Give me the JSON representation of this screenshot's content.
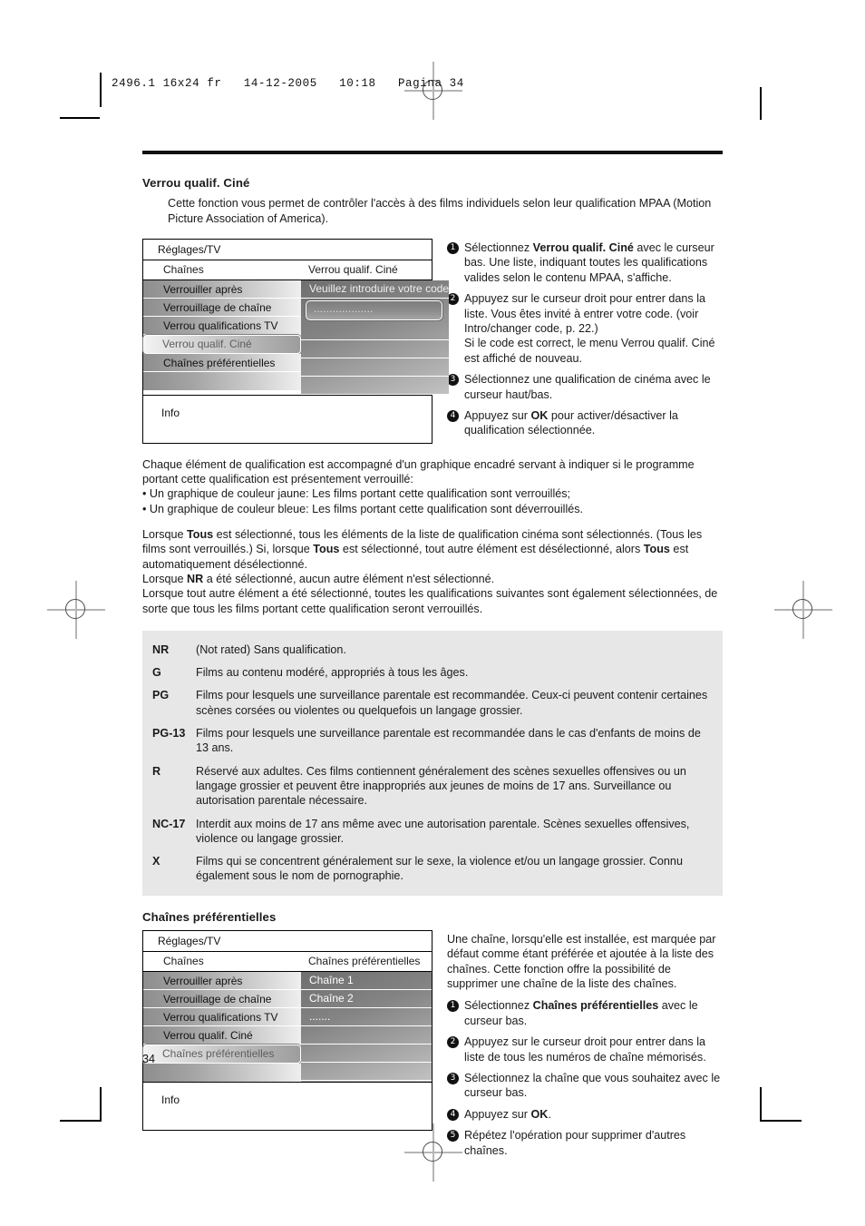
{
  "print_marks": {
    "slug_line": "2496.1 16x24 fr   14-12-2005   10:18   Pagina 34"
  },
  "folio": "34",
  "section1": {
    "title": "Verrou qualif. Ciné",
    "intro": "Cette fonction vous permet de contrôler l'accès à des films individuels selon leur qualification MPAA (Motion Picture Association of America).",
    "tv_menu": {
      "breadcrumb": "Réglages/TV",
      "left_header": "Chaînes",
      "right_header": "Verrou qualif. Ciné",
      "left_items": [
        "Verrouiller après",
        "Verrouillage de chaîne",
        "Verrou qualifications TV",
        "Verrou qualif. Ciné",
        "Chaînes préférentielles"
      ],
      "selected_left_item": "Verrou qualif. Ciné",
      "right_prompt": "Veuillez introduire votre code",
      "code_field_value": "...................",
      "info_label": "Info"
    },
    "steps": [
      {
        "num": "1",
        "html": "Sélectionnez <b>Verrou qualif. Ciné</b> avec le curseur bas. Une liste, indiquant toutes les qualifications valides selon le contenu MPAA, s'affiche."
      },
      {
        "num": "2",
        "html": "Appuyez sur le curseur droit pour entrer dans la liste. Vous êtes invité à entrer votre code. (voir Intro/changer code, p. 22.)<br>Si le code est correct, le menu Verrou qualif. Ciné est affiché de nouveau."
      },
      {
        "num": "3",
        "html": "Sélectionnez une qualification de cinéma avec le curseur haut/bas."
      },
      {
        "num": "4",
        "html": "Appuyez sur <b>OK</b> pour activer/désactiver la qualification sélectionnée."
      }
    ],
    "body_paragraphs": [
      {
        "gap": false,
        "html": "Chaque élément de qualification est accompagné d'un graphique encadré servant à indiquer si le programme portant cette qualification est présentement verrouillé:"
      },
      {
        "gap": false,
        "html": "• Un graphique de couleur jaune: Les films portant cette qualification sont verrouillés;"
      },
      {
        "gap": false,
        "html": "• Un graphique de couleur bleue: Les films portant cette qualification sont déverrouillés."
      },
      {
        "gap": true,
        "html": "Lorsque <b>Tous</b> est sélectionné, tous les éléments de la liste de qualification cinéma sont sélectionnés. (Tous les films sont verrouillés.) Si, lorsque <b>Tous</b> est sélectionné, tout autre élément est désélectionné, alors <b>Tous</b> est automatiquement désélectionné."
      },
      {
        "gap": false,
        "html": "Lorsque <b>NR</b> a été sélectionné, aucun autre élément n'est sélectionné."
      },
      {
        "gap": false,
        "html": "Lorsque tout autre élément a été sélectionné, toutes les qualifications suivantes sont également sélectionnées, de sorte que tous les films portant cette qualification seront verrouillés."
      }
    ],
    "ratings": [
      {
        "code": "NR",
        "desc": "(Not rated) Sans qualification."
      },
      {
        "code": "G",
        "desc": "Films au contenu modéré, appropriés à tous les âges."
      },
      {
        "code": "PG",
        "desc": "Films pour lesquels une surveillance parentale est recommandée. Ceux-ci peuvent contenir certaines scènes corsées ou violentes ou quelquefois un langage grossier."
      },
      {
        "code": "PG-13",
        "desc": "Films pour lesquels une surveillance parentale est recommandée dans le cas d'enfants de moins de 13 ans."
      },
      {
        "code": "R",
        "desc": "Réservé aux adultes. Ces films contiennent généralement des scènes sexuelles offensives ou un langage grossier et peuvent être inappropriés aux jeunes de moins de 17 ans. Surveillance ou autorisation parentale nécessaire."
      },
      {
        "code": "NC-17",
        "desc": "Interdit aux moins de 17 ans même avec une autorisation parentale. Scènes sexuelles offensives, violence ou langage grossier."
      },
      {
        "code": "X",
        "desc": "Films qui se concentrent généralement sur le sexe, la violence et/ou un langage grossier. Connu également sous le nom de pornographie."
      }
    ]
  },
  "section2": {
    "title": "Chaînes préférentielles",
    "tv_menu": {
      "breadcrumb": "Réglages/TV",
      "left_header": "Chaînes",
      "right_header": "Chaînes préférentielles",
      "left_items": [
        "Verrouiller après",
        "Verrouillage de chaîne",
        "Verrou qualifications TV",
        "Verrou qualif. Ciné",
        "Chaînes préférentielles"
      ],
      "selected_left_item": "Chaînes préférentielles",
      "right_items": [
        "Chaîne 1",
        "Chaîne 2",
        "......."
      ],
      "info_label": "Info"
    },
    "lead": "Une chaîne, lorsqu'elle est installée, est marquée par défaut comme étant préférée et ajoutée à la liste des chaînes. Cette fonction offre la possibilité de supprimer une chaîne de la liste des chaînes.",
    "steps": [
      {
        "num": "1",
        "html": "Sélectionnez <b>Chaînes préférentielles</b> avec le curseur bas."
      },
      {
        "num": "2",
        "html": "Appuyez sur le curseur droit pour entrer dans la liste de tous les numéros de chaîne mémorisés."
      },
      {
        "num": "3",
        "html": "Sélectionnez la chaîne que vous souhaitez avec le curseur bas."
      },
      {
        "num": "4",
        "html": "Appuyez sur <b>OK</b>."
      },
      {
        "num": "5",
        "html": "Répétez l'opération pour supprimer d'autres chaînes."
      }
    ]
  }
}
